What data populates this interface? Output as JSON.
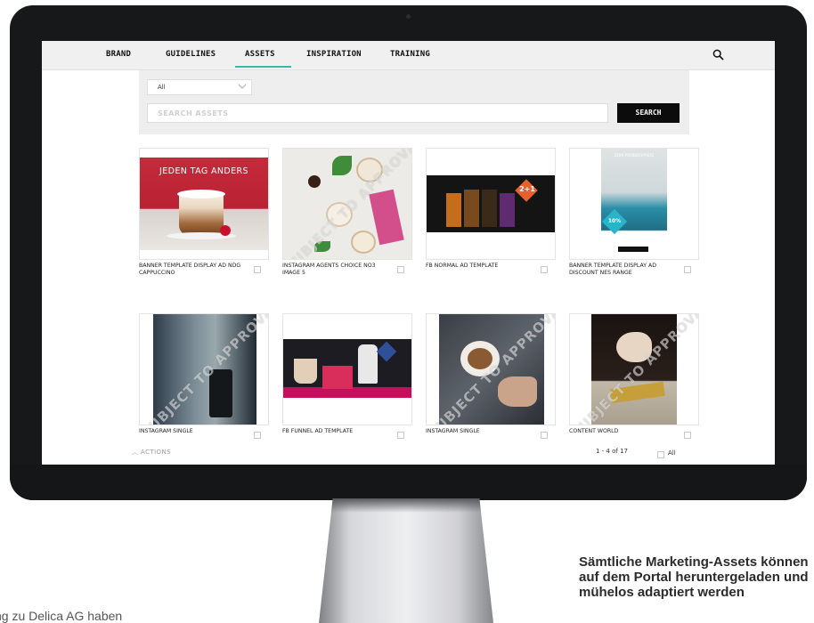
{
  "nav": {
    "items": [
      "BRAND",
      "GUIDELINES",
      "ASSETS",
      "INSPIRATION",
      "TRAINING"
    ],
    "active": "ASSETS"
  },
  "search": {
    "filter_value": "All",
    "placeholder": "SEARCH ASSETS",
    "button_label": "SEARCH"
  },
  "assets": [
    {
      "title": "BANNER TEMPLATE DISPLAY AD NDG CAPPUCCINO",
      "thumb_text": "JEDEN TAG ANDERS",
      "stamp": ""
    },
    {
      "title": "INSTAGRAM AGENTS CHOICE NO3 IMAGE 5",
      "thumb_text": "",
      "stamp": "SUBJECT TO APPROVAL"
    },
    {
      "title": "FB NORMAL AD TEMPLATE",
      "thumb_text": "2+1",
      "stamp": ""
    },
    {
      "title": "BANNER TEMPLATE DISPLAY AD DISCOUNT NES RANGE",
      "thumb_text": "ZUM PROBIERPREIS",
      "badge": "10%",
      "stamp": ""
    },
    {
      "title": "INSTAGRAM SINGLE",
      "stamp": "SUBJECT TO APPROVAL"
    },
    {
      "title": "FB FUNNEL AD TEMPLATE",
      "stamp": ""
    },
    {
      "title": "INSTAGRAM SINGLE",
      "stamp": "SUBJECT TO APPROVAL"
    },
    {
      "title": "CONTENT WORLD",
      "stamp": "SUBJECT TO APPROVAL"
    }
  ],
  "footer": {
    "actions_label": "ACTIONS",
    "pagination": "1 - 4 of 17",
    "all_label": "All"
  },
  "captions": {
    "left": "ng zu Delica AG haben",
    "right": "Sämtliche Marketing-Assets können auf dem Portal heruntergeladen und mühelos adaptiert werden"
  },
  "colors": {
    "accent": "#3fb7a7",
    "button": "#0c0c0c"
  }
}
